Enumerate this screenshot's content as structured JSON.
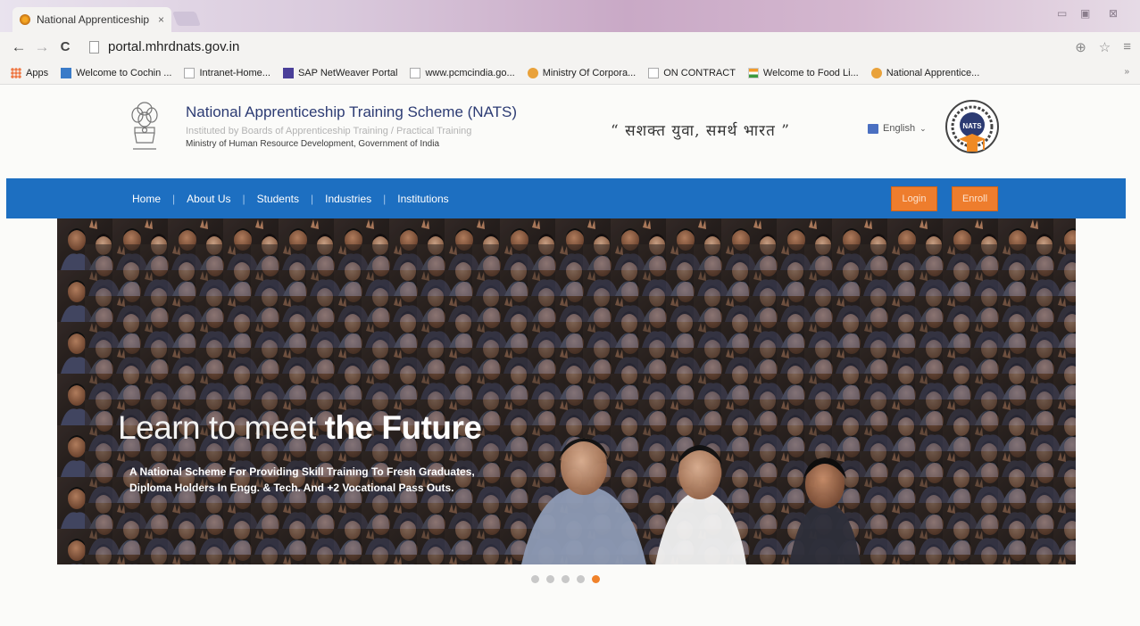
{
  "browser": {
    "tab_title": "National Apprenticeship",
    "tab_close": "×",
    "url": "portal.mhrdnats.gov.in",
    "back": "←",
    "forward": "→",
    "reload": "C",
    "menu": "≡",
    "bookmarks": [
      {
        "label": "Apps",
        "icon": "apps-grid-icon"
      },
      {
        "label": "Welcome to Cochin ...",
        "icon": "site-icon"
      },
      {
        "label": "Intranet-Home...",
        "icon": "page-icon"
      },
      {
        "label": "SAP NetWeaver Portal",
        "icon": "sap-icon"
      },
      {
        "label": "www.pcmcindia.go...",
        "icon": "page-icon"
      },
      {
        "label": "Ministry Of Corpora...",
        "icon": "emblem-icon"
      },
      {
        "label": "ON CONTRACT",
        "icon": "page-icon"
      },
      {
        "label": "Welcome to Food Li...",
        "icon": "flag-icon"
      },
      {
        "label": "National Apprentice...",
        "icon": "nats-icon"
      }
    ],
    "bookmarks_more": "»"
  },
  "header": {
    "title": "National Apprenticeship Training Scheme (NATS)",
    "subtitle1": "Instituted by Boards of Apprenticeship Training / Practical Training",
    "subtitle2": "Ministry of Human Resource Development, Government of India",
    "slogan": "“ सशक्त युवा, समर्थ भारत ”",
    "language": "English",
    "language_caret": "⌄",
    "logo_text": "NATS"
  },
  "nav": {
    "items": [
      "Home",
      "About Us",
      "Students",
      "Industries",
      "Institutions"
    ],
    "separator": "|",
    "login": "Login",
    "enroll": "Enroll"
  },
  "hero": {
    "headline_light": "Learn to meet ",
    "headline_bold": "the Future",
    "line1": "A National Scheme For Providing Skill Training To Fresh Graduates,",
    "line2": "Diploma Holders In Engg. & Tech. And +2 Vocational Pass Outs."
  },
  "carousel": {
    "slide_count": 5,
    "active_index": 4
  },
  "colors": {
    "nav_blue": "#1d6fc1",
    "button_orange": "#ee7d2d",
    "brand_navy": "#2c3b73",
    "dot_active": "#f0822a"
  }
}
